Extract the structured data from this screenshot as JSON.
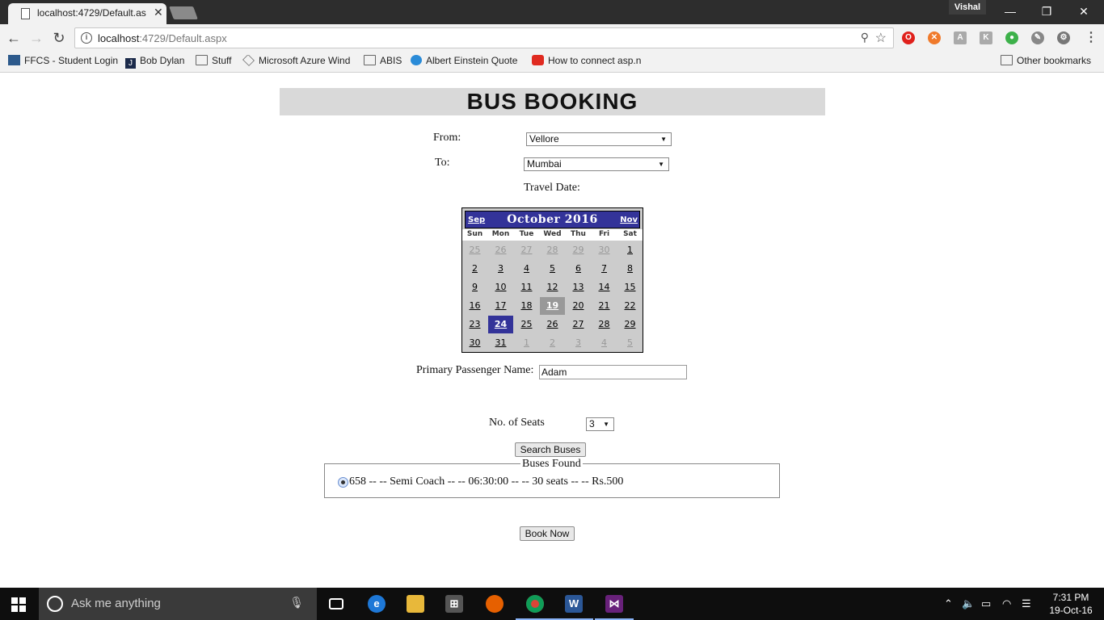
{
  "browser": {
    "tab_title": "localhost:4729/Default.as",
    "tab_close": "✕",
    "profile_name": "Vishal",
    "window_controls": {
      "minimize": "—",
      "restore": "❐",
      "close": "✕"
    },
    "nav": {
      "back": "←",
      "forward": "→",
      "reload": "↻"
    },
    "url_host": "localhost",
    "url_rest": ":4729/Default.aspx",
    "bookmarks": [
      {
        "label": "FFCS - Student Login"
      },
      {
        "label": "Bob Dylan"
      },
      {
        "label": "Stuff"
      },
      {
        "label": "Microsoft Azure Wind"
      },
      {
        "label": "ABIS"
      },
      {
        "label": "Albert Einstein Quote"
      },
      {
        "label": "How to connect asp.n"
      }
    ],
    "other_bookmarks": "Other bookmarks"
  },
  "page": {
    "title": "BUS BOOKING",
    "from_label": "From:",
    "from_value": "Vellore",
    "to_label": "To:",
    "to_value": "Mumbai",
    "travel_date_label": "Travel Date:",
    "passenger_label": "Primary Passenger Name:",
    "passenger_value": "Adam",
    "seats_label": "No. of Seats",
    "seats_value": "3",
    "search_button": "Search Buses",
    "buses_legend": "Buses Found",
    "bus_option": "658 -- -- Semi Coach -- -- 06:30:00 -- -- 30 seats -- -- Rs.500",
    "book_button": "Book Now"
  },
  "calendar": {
    "prev": "Sep",
    "next": "Nov",
    "title": "October 2016",
    "dow": [
      "Sun",
      "Mon",
      "Tue",
      "Wed",
      "Thu",
      "Fri",
      "Sat"
    ],
    "weeks": [
      [
        "25",
        "26",
        "27",
        "28",
        "29",
        "30",
        "1"
      ],
      [
        "2",
        "3",
        "4",
        "5",
        "6",
        "7",
        "8"
      ],
      [
        "9",
        "10",
        "11",
        "12",
        "13",
        "14",
        "15"
      ],
      [
        "16",
        "17",
        "18",
        "19",
        "20",
        "21",
        "22"
      ],
      [
        "23",
        "24",
        "25",
        "26",
        "27",
        "28",
        "29"
      ],
      [
        "30",
        "31",
        "1",
        "2",
        "3",
        "4",
        "5"
      ]
    ],
    "other_month": [
      [
        true,
        true,
        true,
        true,
        true,
        true,
        false
      ],
      [
        false,
        false,
        false,
        false,
        false,
        false,
        false
      ],
      [
        false,
        false,
        false,
        false,
        false,
        false,
        false
      ],
      [
        false,
        false,
        false,
        false,
        false,
        false,
        false
      ],
      [
        false,
        false,
        false,
        false,
        false,
        false,
        false
      ],
      [
        false,
        false,
        true,
        true,
        true,
        true,
        true
      ]
    ],
    "today": "19",
    "selected": "24",
    "header_color": "#333399"
  },
  "taskbar": {
    "search_placeholder": "Ask me anything",
    "time": "7:31 PM",
    "date": "19-Oct-16"
  }
}
